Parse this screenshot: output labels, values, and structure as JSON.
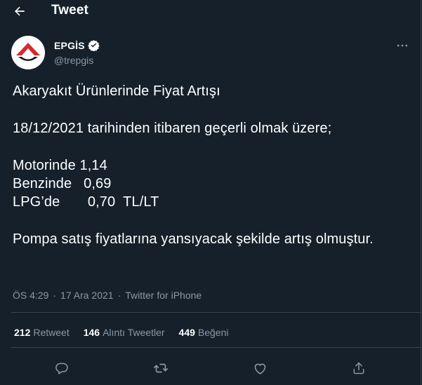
{
  "header": {
    "title": "Tweet",
    "back_icon": "arrow-left-icon"
  },
  "author": {
    "name": "EPGİS",
    "handle": "@trepgis",
    "verified": true,
    "verified_color": "#ffffff"
  },
  "tweet": {
    "text": "Akaryakıt Ürünlerinde Fiyat Artışı\n\n18/12/2021 tarihinden itibaren geçerli olmak üzere;\n\nMotorinde 1,14\nBenzinde   0,69\nLPG’de       0,70  TL/LT\n\nPompa satış fiyatlarına yansıyacak şekilde artış olmuştur.",
    "time": "ÖS 4:29",
    "date": "17 Ara 2021",
    "separator": "·",
    "source": "Twitter for iPhone"
  },
  "stats": [
    {
      "count": "212",
      "label": "Retweet"
    },
    {
      "count": "146",
      "label": "Alıntı Tweetler"
    },
    {
      "count": "449",
      "label": "Beğeni"
    }
  ],
  "actions": [
    "reply-icon",
    "retweet-icon",
    "like-icon",
    "share-icon"
  ],
  "colors": {
    "background": "#15202b",
    "border": "#38444d",
    "secondary_text": "#8b98a5",
    "primary_text": "#ffffff",
    "logo_red": "#d7282f"
  }
}
